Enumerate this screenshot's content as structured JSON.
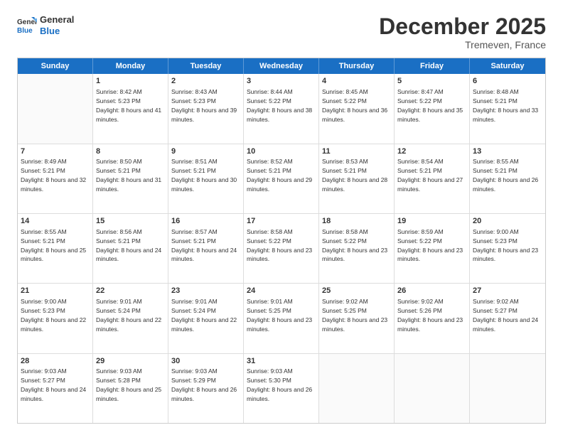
{
  "logo": {
    "line1": "General",
    "line2": "Blue"
  },
  "title": "December 2025",
  "location": "Tremeven, France",
  "header_days": [
    "Sunday",
    "Monday",
    "Tuesday",
    "Wednesday",
    "Thursday",
    "Friday",
    "Saturday"
  ],
  "weeks": [
    [
      {
        "day": "",
        "sunrise": "",
        "sunset": "",
        "daylight": ""
      },
      {
        "day": "1",
        "sunrise": "Sunrise: 8:42 AM",
        "sunset": "Sunset: 5:23 PM",
        "daylight": "Daylight: 8 hours and 41 minutes."
      },
      {
        "day": "2",
        "sunrise": "Sunrise: 8:43 AM",
        "sunset": "Sunset: 5:23 PM",
        "daylight": "Daylight: 8 hours and 39 minutes."
      },
      {
        "day": "3",
        "sunrise": "Sunrise: 8:44 AM",
        "sunset": "Sunset: 5:22 PM",
        "daylight": "Daylight: 8 hours and 38 minutes."
      },
      {
        "day": "4",
        "sunrise": "Sunrise: 8:45 AM",
        "sunset": "Sunset: 5:22 PM",
        "daylight": "Daylight: 8 hours and 36 minutes."
      },
      {
        "day": "5",
        "sunrise": "Sunrise: 8:47 AM",
        "sunset": "Sunset: 5:22 PM",
        "daylight": "Daylight: 8 hours and 35 minutes."
      },
      {
        "day": "6",
        "sunrise": "Sunrise: 8:48 AM",
        "sunset": "Sunset: 5:21 PM",
        "daylight": "Daylight: 8 hours and 33 minutes."
      }
    ],
    [
      {
        "day": "7",
        "sunrise": "Sunrise: 8:49 AM",
        "sunset": "Sunset: 5:21 PM",
        "daylight": "Daylight: 8 hours and 32 minutes."
      },
      {
        "day": "8",
        "sunrise": "Sunrise: 8:50 AM",
        "sunset": "Sunset: 5:21 PM",
        "daylight": "Daylight: 8 hours and 31 minutes."
      },
      {
        "day": "9",
        "sunrise": "Sunrise: 8:51 AM",
        "sunset": "Sunset: 5:21 PM",
        "daylight": "Daylight: 8 hours and 30 minutes."
      },
      {
        "day": "10",
        "sunrise": "Sunrise: 8:52 AM",
        "sunset": "Sunset: 5:21 PM",
        "daylight": "Daylight: 8 hours and 29 minutes."
      },
      {
        "day": "11",
        "sunrise": "Sunrise: 8:53 AM",
        "sunset": "Sunset: 5:21 PM",
        "daylight": "Daylight: 8 hours and 28 minutes."
      },
      {
        "day": "12",
        "sunrise": "Sunrise: 8:54 AM",
        "sunset": "Sunset: 5:21 PM",
        "daylight": "Daylight: 8 hours and 27 minutes."
      },
      {
        "day": "13",
        "sunrise": "Sunrise: 8:55 AM",
        "sunset": "Sunset: 5:21 PM",
        "daylight": "Daylight: 8 hours and 26 minutes."
      }
    ],
    [
      {
        "day": "14",
        "sunrise": "Sunrise: 8:55 AM",
        "sunset": "Sunset: 5:21 PM",
        "daylight": "Daylight: 8 hours and 25 minutes."
      },
      {
        "day": "15",
        "sunrise": "Sunrise: 8:56 AM",
        "sunset": "Sunset: 5:21 PM",
        "daylight": "Daylight: 8 hours and 24 minutes."
      },
      {
        "day": "16",
        "sunrise": "Sunrise: 8:57 AM",
        "sunset": "Sunset: 5:21 PM",
        "daylight": "Daylight: 8 hours and 24 minutes."
      },
      {
        "day": "17",
        "sunrise": "Sunrise: 8:58 AM",
        "sunset": "Sunset: 5:22 PM",
        "daylight": "Daylight: 8 hours and 23 minutes."
      },
      {
        "day": "18",
        "sunrise": "Sunrise: 8:58 AM",
        "sunset": "Sunset: 5:22 PM",
        "daylight": "Daylight: 8 hours and 23 minutes."
      },
      {
        "day": "19",
        "sunrise": "Sunrise: 8:59 AM",
        "sunset": "Sunset: 5:22 PM",
        "daylight": "Daylight: 8 hours and 23 minutes."
      },
      {
        "day": "20",
        "sunrise": "Sunrise: 9:00 AM",
        "sunset": "Sunset: 5:23 PM",
        "daylight": "Daylight: 8 hours and 23 minutes."
      }
    ],
    [
      {
        "day": "21",
        "sunrise": "Sunrise: 9:00 AM",
        "sunset": "Sunset: 5:23 PM",
        "daylight": "Daylight: 8 hours and 22 minutes."
      },
      {
        "day": "22",
        "sunrise": "Sunrise: 9:01 AM",
        "sunset": "Sunset: 5:24 PM",
        "daylight": "Daylight: 8 hours and 22 minutes."
      },
      {
        "day": "23",
        "sunrise": "Sunrise: 9:01 AM",
        "sunset": "Sunset: 5:24 PM",
        "daylight": "Daylight: 8 hours and 22 minutes."
      },
      {
        "day": "24",
        "sunrise": "Sunrise: 9:01 AM",
        "sunset": "Sunset: 5:25 PM",
        "daylight": "Daylight: 8 hours and 23 minutes."
      },
      {
        "day": "25",
        "sunrise": "Sunrise: 9:02 AM",
        "sunset": "Sunset: 5:25 PM",
        "daylight": "Daylight: 8 hours and 23 minutes."
      },
      {
        "day": "26",
        "sunrise": "Sunrise: 9:02 AM",
        "sunset": "Sunset: 5:26 PM",
        "daylight": "Daylight: 8 hours and 23 minutes."
      },
      {
        "day": "27",
        "sunrise": "Sunrise: 9:02 AM",
        "sunset": "Sunset: 5:27 PM",
        "daylight": "Daylight: 8 hours and 24 minutes."
      }
    ],
    [
      {
        "day": "28",
        "sunrise": "Sunrise: 9:03 AM",
        "sunset": "Sunset: 5:27 PM",
        "daylight": "Daylight: 8 hours and 24 minutes."
      },
      {
        "day": "29",
        "sunrise": "Sunrise: 9:03 AM",
        "sunset": "Sunset: 5:28 PM",
        "daylight": "Daylight: 8 hours and 25 minutes."
      },
      {
        "day": "30",
        "sunrise": "Sunrise: 9:03 AM",
        "sunset": "Sunset: 5:29 PM",
        "daylight": "Daylight: 8 hours and 26 minutes."
      },
      {
        "day": "31",
        "sunrise": "Sunrise: 9:03 AM",
        "sunset": "Sunset: 5:30 PM",
        "daylight": "Daylight: 8 hours and 26 minutes."
      },
      {
        "day": "",
        "sunrise": "",
        "sunset": "",
        "daylight": ""
      },
      {
        "day": "",
        "sunrise": "",
        "sunset": "",
        "daylight": ""
      },
      {
        "day": "",
        "sunrise": "",
        "sunset": "",
        "daylight": ""
      }
    ]
  ]
}
